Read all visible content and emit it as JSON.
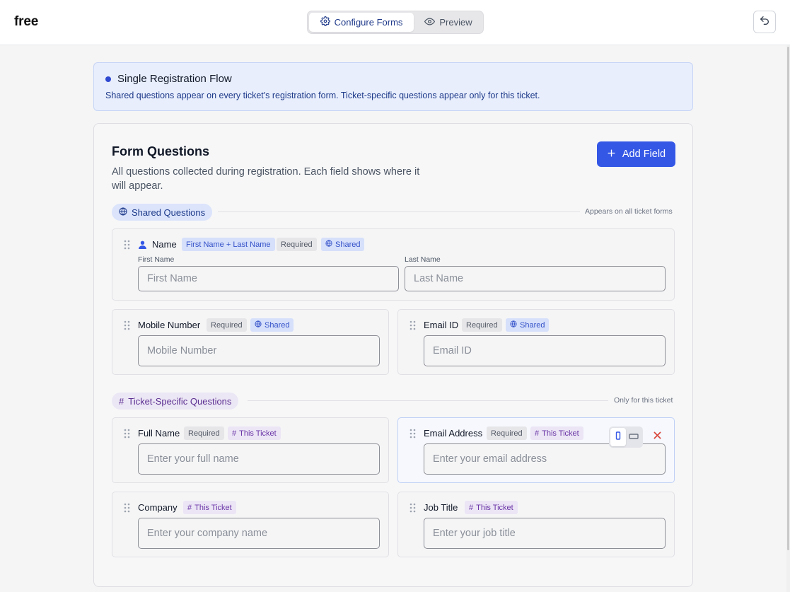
{
  "app": {
    "logo": "free"
  },
  "header": {
    "tabs": [
      {
        "label": "Configure Forms",
        "icon": "gear-icon",
        "active": true
      },
      {
        "label": "Preview",
        "icon": "eye-icon",
        "active": false
      }
    ],
    "undo_icon": "undo-icon"
  },
  "banner": {
    "title": "Single Registration Flow",
    "text": "Shared questions appear on every ticket's registration form. Ticket-specific questions appear only for this ticket."
  },
  "form": {
    "title": "Form Questions",
    "description": "All questions collected during registration. Each field shows where it will appear.",
    "add_label": "Add Field"
  },
  "shared_section": {
    "label": "Shared Questions",
    "note": "Appears on all ticket forms",
    "name_field": {
      "label": "Name",
      "combo_tag": "First Name + Last Name",
      "required_tag": "Required",
      "shared_tag": "Shared",
      "first_label": "First Name",
      "first_placeholder": "First Name",
      "last_label": "Last Name",
      "last_placeholder": "Last Name"
    },
    "mobile_field": {
      "label": "Mobile Number",
      "required_tag": "Required",
      "shared_tag": "Shared",
      "placeholder": "Mobile Number"
    },
    "email_field": {
      "label": "Email ID",
      "required_tag": "Required",
      "shared_tag": "Shared",
      "placeholder": "Email ID"
    }
  },
  "ticket_section": {
    "label": "Ticket-Specific Questions",
    "note": "Only for this ticket",
    "full_name": {
      "label": "Full Name",
      "required_tag": "Required",
      "ticket_tag": "This Ticket",
      "placeholder": "Enter your full name"
    },
    "email_address": {
      "label": "Email Address",
      "required_tag": "Required",
      "ticket_tag": "This Ticket",
      "placeholder": "Enter your email address"
    },
    "company": {
      "label": "Company",
      "ticket_tag": "This Ticket",
      "placeholder": "Enter your company name"
    },
    "job_title": {
      "label": "Job Title",
      "ticket_tag": "This Ticket",
      "placeholder": "Enter your job title"
    }
  },
  "colors": {
    "accent": "#3457e6",
    "shared_tag_bg": "#d6e0fa",
    "ticket_tag_bg": "#ebe5f5",
    "delete": "#d9443a"
  }
}
